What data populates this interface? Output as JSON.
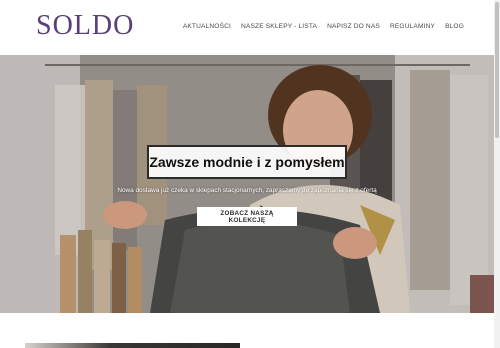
{
  "brand": {
    "logo_text": "SOLDO"
  },
  "nav": {
    "items": [
      {
        "label": "AKTUALNOŚCI"
      },
      {
        "label": "NASZE SKLEPY - LISTA"
      },
      {
        "label": "NAPISZ DO NAS"
      },
      {
        "label": "REGULAMINY"
      },
      {
        "label": "BLOG"
      }
    ]
  },
  "hero": {
    "title": "Zawsze modnie i z pomysłem",
    "subtitle": "Nowa dostawa już czeka w sklepach stacjonarnych, zapraszamy do zapoznania się z ofertą",
    "cta_label": "ZOBACZ NASZĄ KOLEKCJĘ"
  },
  "colors": {
    "brand": "#5a3f7a",
    "nav_text": "#4a4a4a",
    "hero_title_border": "#2b2b2b"
  }
}
